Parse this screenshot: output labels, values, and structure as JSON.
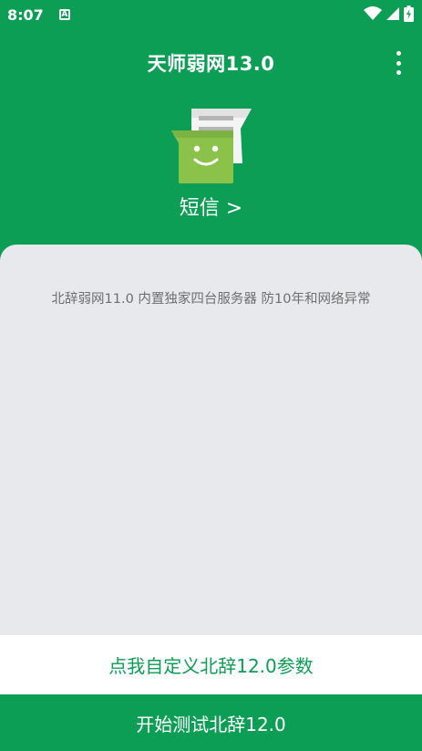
{
  "status_bar": {
    "time": "8:07",
    "notification_icon_letter": "A",
    "icons": [
      "wifi-icon",
      "signal-icon",
      "battery-icon"
    ]
  },
  "toolbar": {
    "title": "天师弱网13.0",
    "menu_icon": "more-vert-icon"
  },
  "app": {
    "icon": "sms-app-icon",
    "label": "短信 >"
  },
  "content": {
    "description": "北辞弱网11.0 内置独家四台服务器 防10年和网络异常"
  },
  "actions": {
    "custom_label": "点我自定义北辞12.0参数",
    "start_label": "开始测试北辞12.0"
  },
  "colors": {
    "primary": "#0c9e55",
    "card_background": "#e8e9ed",
    "text_gray": "#6e6e6e"
  }
}
